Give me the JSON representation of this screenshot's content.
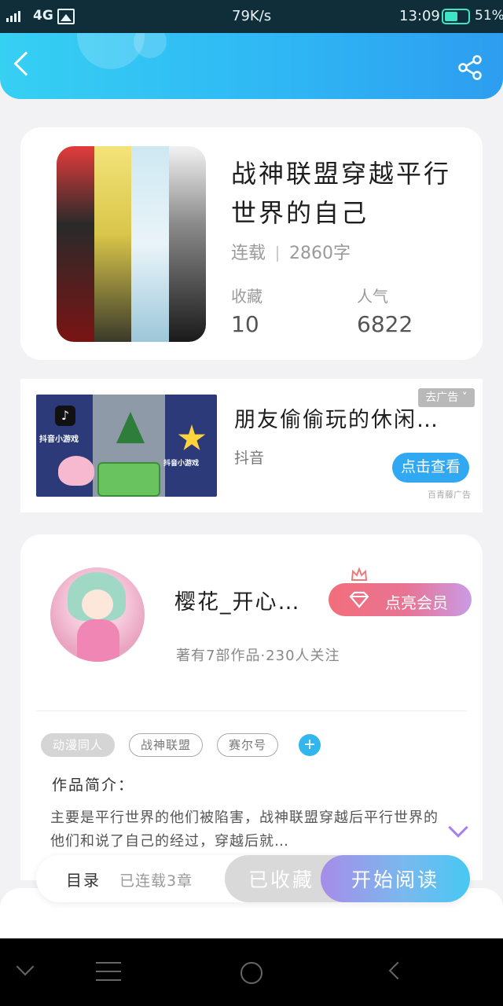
{
  "status_bar": {
    "network": "4G",
    "speed": "79K/s",
    "time": "13:09",
    "battery": "51%"
  },
  "header": {
    "back_icon": "back-arrow-icon",
    "share_icon": "share-icon"
  },
  "book": {
    "title": "战神联盟穿越平行世界的自己",
    "status": "连载",
    "word_count": "2860字",
    "favorites_label": "收藏",
    "favorites_value": "10",
    "popularity_label": "人气",
    "popularity_value": "6822"
  },
  "ad": {
    "title": "朋友偷偷玩的休闲…",
    "source": "抖音",
    "tag": "去广告",
    "button": "点击查看",
    "provider": "百青藤广告",
    "image_text_left": "抖音小游戏",
    "image_text_right": "抖音小游戏"
  },
  "author": {
    "name": "樱花_开心…",
    "vip_button": "点亮会员",
    "stats": "著有7部作品·230人关注",
    "tags": [
      "动漫同人",
      "战神联盟",
      "赛尔号"
    ],
    "add_tag": "+",
    "intro_title": "作品简介：",
    "intro_text": "主要是平行世界的他们被陷害，战神联盟穿越后平行世界的他们和说了自己的经过，穿越后就…"
  },
  "action_bar": {
    "toc_label": "目录",
    "chapters": "已连载3章",
    "favorited": "已收藏",
    "start_reading": "开始阅读"
  },
  "colors": {
    "header_gradient_start": "#36d0f3",
    "header_gradient_end": "#2d9df0",
    "accent_blue": "#30a8f2",
    "vip_pink": "#f26e7b",
    "read_purple": "#a78ce8",
    "battery_green": "#3ee6c8"
  }
}
